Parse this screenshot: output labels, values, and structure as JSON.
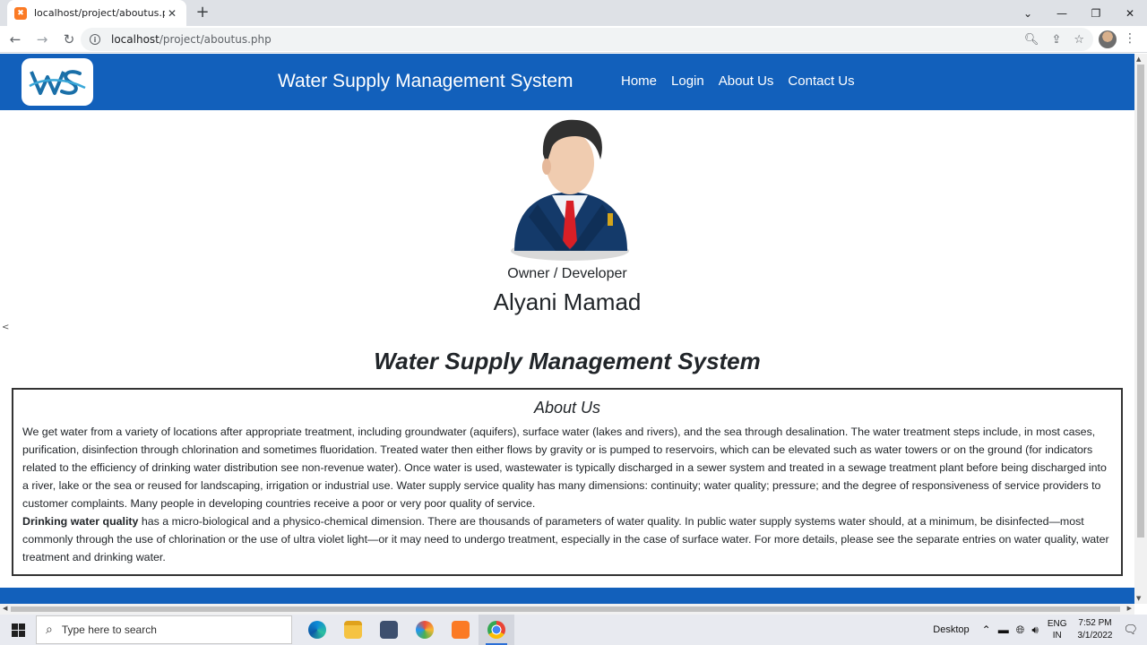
{
  "browser": {
    "tab_title": "localhost/project/aboutus.php",
    "url_host": "localhost",
    "url_path": "/project/aboutus.php"
  },
  "site": {
    "brand": "Water Supply Management System",
    "nav": [
      "Home",
      "Login",
      "About Us",
      "Contact Us"
    ]
  },
  "profile": {
    "role": "Owner / Developer",
    "name": "Alyani Mamad"
  },
  "main_title": "Water Supply Management System",
  "about": {
    "heading": "About Us",
    "para1": "We get water from a variety of locations after appropriate treatment, including groundwater (aquifers), surface water (lakes and rivers), and the sea through desalination. The water treatment steps include, in most cases, purification, disinfection through chlorination and sometimes fluoridation. Treated water then either flows by gravity or is pumped to reservoirs, which can be elevated such as water towers or on the ground (for indicators related to the efficiency of drinking water distribution see non-revenue water). Once water is used, wastewater is typically discharged in a sewer system and treated in a sewage treatment plant before being discharged into a river, lake or the sea or reused for landscaping, irrigation or industrial use. Water supply service quality has many dimensions: continuity; water quality; pressure; and the degree of responsiveness of service providers to customer complaints. Many people in developing countries receive a poor or very poor quality of service.",
    "para2_bold": "Drinking water quality",
    "para2": " has a micro-biological and a physico-chemical dimension. There are thousands of parameters of water quality. In public water supply systems water should, at a minimum, be disinfected—most commonly through the use of chlorination or the use of ultra violet light—or it may need to undergo treatment, especially in the case of surface water. For more details, please see the separate entries on water quality, water treatment and drinking water."
  },
  "misc": {
    "left_chevron": "<"
  },
  "taskbar": {
    "search_placeholder": "Type here to search",
    "desktop_label": "Desktop",
    "lang_line1": "ENG",
    "lang_line2": "IN",
    "time": "7:52 PM",
    "date": "3/1/2022"
  },
  "colors": {
    "navbar": "#1260bb",
    "accent": "#2b6fd6"
  }
}
